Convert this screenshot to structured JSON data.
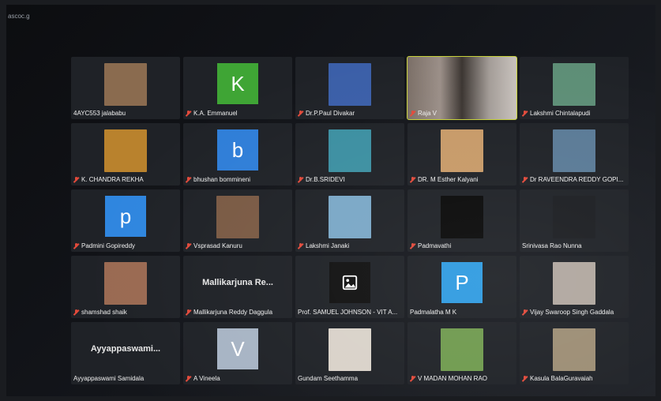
{
  "window": {
    "corner_text": "ascoc.g"
  },
  "participants": [
    {
      "name": "4AYC553 jalababu",
      "muted": false,
      "kind": "photo",
      "color": "#8a6b4f"
    },
    {
      "name": "K.A. Emmanuel",
      "muted": true,
      "kind": "letter",
      "letter": "K",
      "color": "#3fa535"
    },
    {
      "name": "Dr.P.Paul Divakar",
      "muted": true,
      "kind": "photo",
      "color": "#3b5fa8"
    },
    {
      "name": "Raja V",
      "muted": true,
      "kind": "video",
      "active": true
    },
    {
      "name": "Lakshmi Chintalapudi",
      "muted": true,
      "kind": "photo",
      "color": "#5d8e76"
    },
    {
      "name": "K. CHANDRA REKHA",
      "muted": true,
      "kind": "photo",
      "color": "#b9822d"
    },
    {
      "name": "bhushan bommineni",
      "muted": true,
      "kind": "letter",
      "letter": "b",
      "color": "#2f7ed8"
    },
    {
      "name": "Dr.B.SRIDEVI",
      "muted": true,
      "kind": "photo",
      "color": "#3c8fa1"
    },
    {
      "name": "DR. M Esther Kalyani",
      "muted": true,
      "kind": "photo",
      "color": "#c79a68"
    },
    {
      "name": "Dr RAVEENDRA REDDY GOPI...",
      "muted": true,
      "kind": "photo",
      "color": "#5a7a96"
    },
    {
      "name": "Padmini Gopireddy",
      "muted": true,
      "kind": "letter",
      "letter": "p",
      "color": "#2f86df"
    },
    {
      "name": "Vsprasad Kanuru",
      "muted": true,
      "kind": "photo",
      "color": "#7a5a44"
    },
    {
      "name": "Lakshmi Janaki",
      "muted": true,
      "kind": "photo",
      "color": "#7aa7c6"
    },
    {
      "name": "Padmavathi",
      "muted": true,
      "kind": "photo",
      "color": "#0a0a0a"
    },
    {
      "name": "Srinivasa Rao Nunna",
      "muted": false,
      "kind": "photo",
      "color": "#1c1e22"
    },
    {
      "name": "shamshad shaik",
      "muted": true,
      "kind": "photo",
      "color": "#9a6a52"
    },
    {
      "name": "Mallikarjuna Reddy Daggula",
      "muted": true,
      "kind": "text",
      "display": "Mallikarjuna  Re..."
    },
    {
      "name": "Prof. SAMUEL JOHNSON - VIT A...",
      "muted": false,
      "kind": "icon"
    },
    {
      "name": "Padmalatha M K",
      "muted": false,
      "kind": "letter",
      "letter": "P",
      "color": "#2f9be0"
    },
    {
      "name": "Vijay Swaroop Singh Gaddala",
      "muted": true,
      "kind": "photo",
      "color": "#b0a79f"
    },
    {
      "name": "Ayyappaswami Samidala",
      "muted": false,
      "kind": "text",
      "display": "Ayyappaswami..."
    },
    {
      "name": "A Vineela",
      "muted": true,
      "kind": "letter",
      "letter": "V",
      "color": "#a7b4c4"
    },
    {
      "name": "Gundam Seethamma",
      "muted": false,
      "kind": "photo",
      "color": "#d9d2c9"
    },
    {
      "name": "V MADAN MOHAN RAO",
      "muted": true,
      "kind": "photo",
      "color": "#6f9a4e"
    },
    {
      "name": "Kasula BalaGuravaiah",
      "muted": true,
      "kind": "photo",
      "color": "#9c8d74"
    }
  ]
}
